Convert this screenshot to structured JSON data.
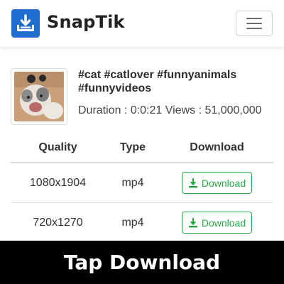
{
  "header": {
    "brand": "SnapTik",
    "logo_icon": "download-tray-icon",
    "menu_icon": "hamburger-menu-icon",
    "accent_color": "#1d6ecf"
  },
  "video": {
    "tags": "#cat #catlover #funnyanimals #funnyvideos",
    "meta": "Duration : 0:0:21 Views : 51,000,000"
  },
  "table": {
    "headers": {
      "quality": "Quality",
      "type": "Type",
      "download": "Download"
    },
    "rows": [
      {
        "quality": "1080x1904",
        "type": "mp4",
        "download_label": "Download"
      },
      {
        "quality": "720x1270",
        "type": "mp4",
        "download_label": "Download"
      }
    ],
    "button_color": "#28a745"
  },
  "banner": {
    "text": "Tap Download"
  }
}
